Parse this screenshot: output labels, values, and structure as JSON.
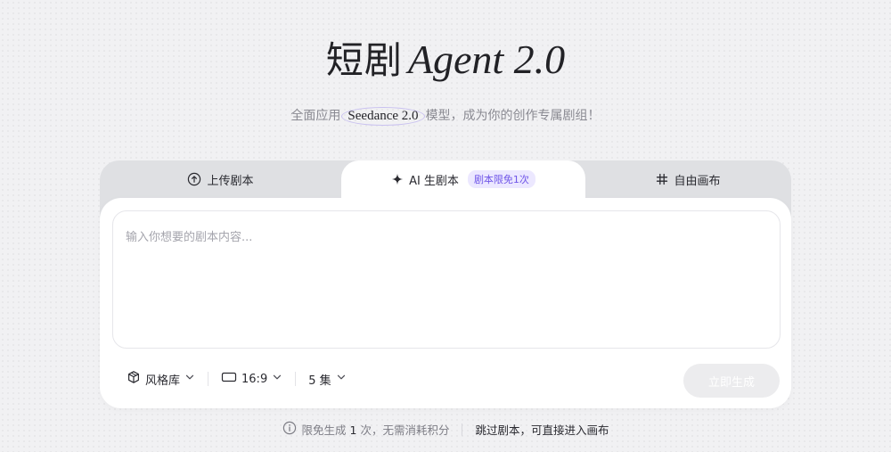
{
  "header": {
    "title_cn": "短剧",
    "title_en": "Agent 2.0",
    "subtitle_prefix": "全面应用",
    "subtitle_model": "Seedance 2.0",
    "subtitle_suffix": "模型，成为你的创作专属剧组！"
  },
  "tabs": [
    {
      "label": "上传剧本",
      "icon": "upload-circle-icon"
    },
    {
      "label": "AI 生剧本",
      "icon": "sparkle-icon",
      "badge": "剧本限免1次",
      "active": true
    },
    {
      "label": "自由画布",
      "icon": "hash-icon"
    }
  ],
  "editor": {
    "placeholder": "输入你想要的剧本内容...",
    "value": ""
  },
  "toolbar": {
    "style_label": "风格库",
    "ratio_label": "16:9",
    "episodes_label": "5 集",
    "generate_label": "立即生成"
  },
  "footer": {
    "quota_prefix": "限免生成",
    "quota_count": "1",
    "quota_suffix": "次，无需消耗积分",
    "skip_label": "跳过剧本，可直接进入画布"
  },
  "colors": {
    "accent": "#6f55e8",
    "badge_bg": "#ece8ff",
    "button_disabled": "#ececee"
  }
}
